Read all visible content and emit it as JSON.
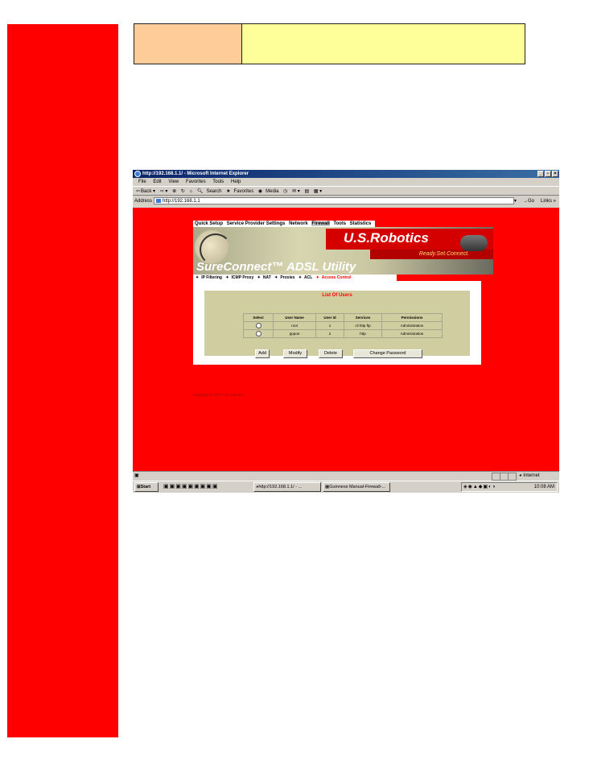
{
  "browser": {
    "window_title": "http://192.168.1.1/ - Microsoft Internet Explorer",
    "menu": [
      "File",
      "Edit",
      "View",
      "Favorites",
      "Tools",
      "Help"
    ],
    "toolbar": {
      "back": "Back",
      "search": "Search",
      "favorites": "Favorites",
      "media": "Media"
    },
    "address": {
      "label": "Address",
      "value": "http://192.168.1.1",
      "go": "Go",
      "links": "Links"
    },
    "status": {
      "zone": "Internet"
    }
  },
  "app": {
    "nav": [
      "Quick Setup",
      "Service Provider Settings",
      "Network",
      "Firewall",
      "Tools",
      "Statistics"
    ],
    "active_nav": "Firewall",
    "brand": "U.S.Robotics",
    "tagline": "Ready.Set.Connect.",
    "title": "SureConnect™ ADSL Utility",
    "sub_nav": [
      "IP Filtering",
      "ICMP Proxy",
      "NAT",
      "Proxies",
      "ACL",
      "Access Control"
    ],
    "active_sub_nav": "Access Control",
    "list_title": "List Of Users",
    "table": {
      "headers": [
        "Select",
        "User Name",
        "User Id",
        "Services",
        "Permissions"
      ],
      "rows": [
        {
          "user": "root",
          "id": "1",
          "services": "cli http ftp",
          "permissions": "Administration"
        },
        {
          "user": "pppoe",
          "id": "2",
          "services": "http",
          "permissions": "Administration"
        }
      ]
    },
    "buttons": {
      "add": "Add",
      "modify": "Modify",
      "delete": "Delete",
      "change_password": "Change Password"
    },
    "copyright": "Copyright © 2002 U.S. Robotics"
  },
  "taskbar": {
    "start": "Start",
    "tasks": [
      "http://192.168.1.1/ - ...",
      "Guinness Manual-Firewall-..."
    ],
    "clock": "10:08 AM"
  },
  "colors": {
    "page_red": "#ff0000",
    "header_peach": "#fecc99",
    "header_yellow": "#ffff99",
    "panel_olive": "#d0cda0"
  }
}
